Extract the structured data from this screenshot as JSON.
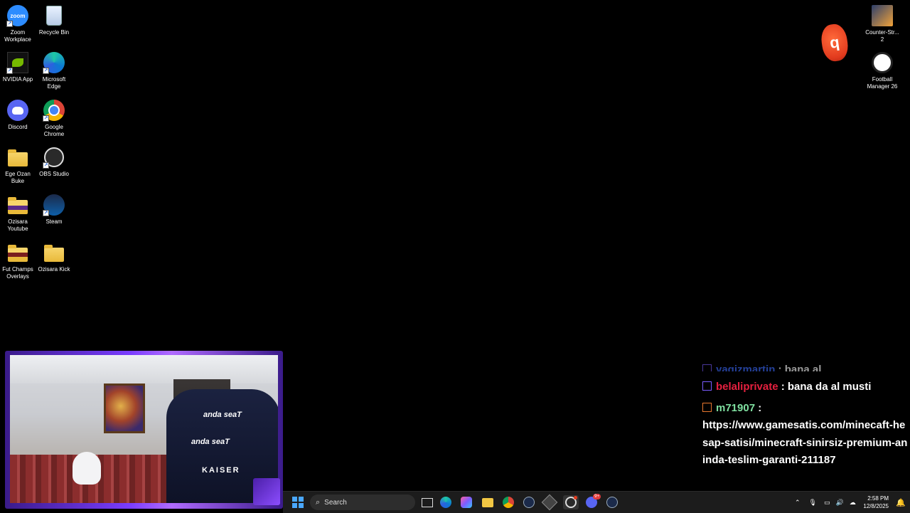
{
  "desktop": {
    "left_icons": [
      {
        "label": "Zoom Workplace",
        "icon": "zoom-icon"
      },
      {
        "label": "Recycle Bin",
        "icon": "recycle-bin-icon"
      },
      {
        "label": "NVIDIA App",
        "icon": "nvidia-icon"
      },
      {
        "label": "Microsoft Edge",
        "icon": "edge-icon"
      },
      {
        "label": "Discord",
        "icon": "discord-icon"
      },
      {
        "label": "Google Chrome",
        "icon": "chrome-icon"
      },
      {
        "label": "Ege Ozan Buke",
        "icon": "folder-icon"
      },
      {
        "label": "OBS Studio",
        "icon": "obs-icon"
      },
      {
        "label": "Ozisara Youtube",
        "icon": "folder-icon"
      },
      {
        "label": "Steam",
        "icon": "steam-icon"
      },
      {
        "label": "Fut Champs Overlays",
        "icon": "folder-icon"
      },
      {
        "label": "Ozisara Kick",
        "icon": "folder-icon"
      }
    ],
    "right_icons": [
      {
        "label": "Counter-Str... 2",
        "icon": "counter-strike-icon"
      },
      {
        "label": "Football Manager 26",
        "icon": "football-manager-icon"
      }
    ]
  },
  "webcam": {
    "chair_brand": "anda seaT",
    "chair_model": "KAISER"
  },
  "chat": {
    "messages": [
      {
        "user": "yagizmartin",
        "text": ": bana al",
        "color": "#3d6bff"
      },
      {
        "user": "belaliprivate",
        "text": ": bana da al musti",
        "color": "#e5203f"
      },
      {
        "user": "m71907",
        "text": ":",
        "color": "#7fe0a0"
      }
    ],
    "link_text": "https://www.gamesatis.com/minecaft-hesap-satisi/minecraft-sinirsiz-premium-aninda-teslim-garanti-211187"
  },
  "taskbar": {
    "search_placeholder": "Search",
    "apps": [
      "windows-start-icon",
      "search-icon",
      "widgets-icon",
      "task-view-icon",
      "edge-icon",
      "copilot-icon",
      "file-explorer-icon",
      "chrome-icon",
      "steam-icon",
      "app-icon",
      "obs-icon",
      "discord-icon",
      "steam-icon"
    ],
    "discord_badge": "9+",
    "time": "2:58 PM",
    "date": "12/8/2025"
  },
  "overlay": {
    "recording_badge_text": "q"
  },
  "colors": {
    "accent_purple": "#7a3dff",
    "taskbar_bg": "#1c1c1c"
  }
}
